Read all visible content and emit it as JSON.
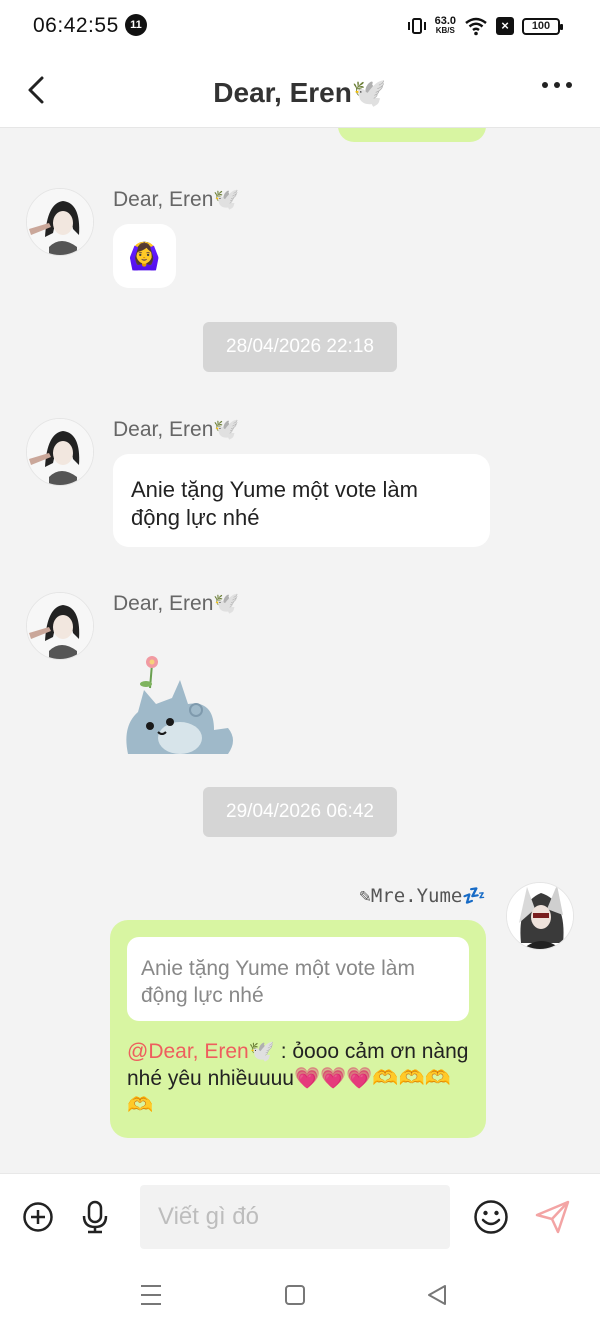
{
  "status_bar": {
    "time": "06:42:55",
    "notification_count": "11",
    "net_speed": "63.0",
    "net_unit": "KB/S",
    "battery": "100"
  },
  "header": {
    "title": "Dear, Eren🕊️"
  },
  "messages": {
    "m1": {
      "sender": "Dear, Eren🕊️",
      "emoji": "🙆‍♀️"
    },
    "time1": "28/04/2026 22:18",
    "m2": {
      "sender": "Dear, Eren🕊️",
      "text": "Anie tặng Yume một vote làm động lực nhé"
    },
    "m3": {
      "sender": "Dear, Eren🕊️",
      "sticker": "cat-sticker"
    },
    "time2": "29/04/2026 06:42",
    "m4": {
      "sender": "✎Mre.Yume💤",
      "quote": "Anie tặng Yume một vote làm động lực nhé",
      "mention": "@Dear, Eren🕊️",
      "text": " : ỏooo cảm ơn nàng nhé yêu nhiềuuuu💗💗💗🫶🫶🫶🫶"
    }
  },
  "input": {
    "placeholder": "Viết gì đó"
  },
  "icons": {
    "add": "plus-circle-icon",
    "mic": "microphone-icon",
    "emoji": "smiley-icon",
    "send": "send-icon"
  },
  "colors": {
    "outgoing_bubble": "#d8f5a2",
    "mention": "#ee5e5e",
    "send_icon": "#f3a4a4"
  }
}
